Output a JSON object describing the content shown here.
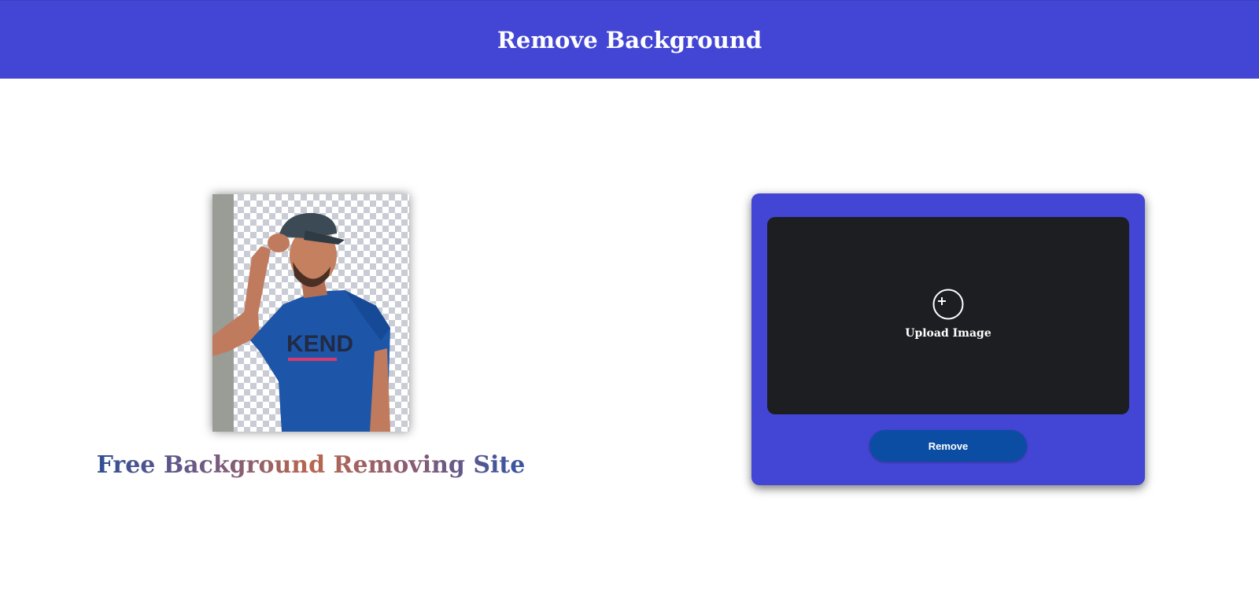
{
  "header": {
    "title": "Remove Background"
  },
  "hero": {
    "image_alt": "person-with-removed-background",
    "tagline": "Free Background Removing Site"
  },
  "upload": {
    "icon": "plus-circle-icon",
    "label": "Upload Image",
    "remove_label": "Remove"
  },
  "colors": {
    "brand": "#4346d4",
    "drop_zone": "#1c1e22",
    "button": "#0b4da2"
  }
}
